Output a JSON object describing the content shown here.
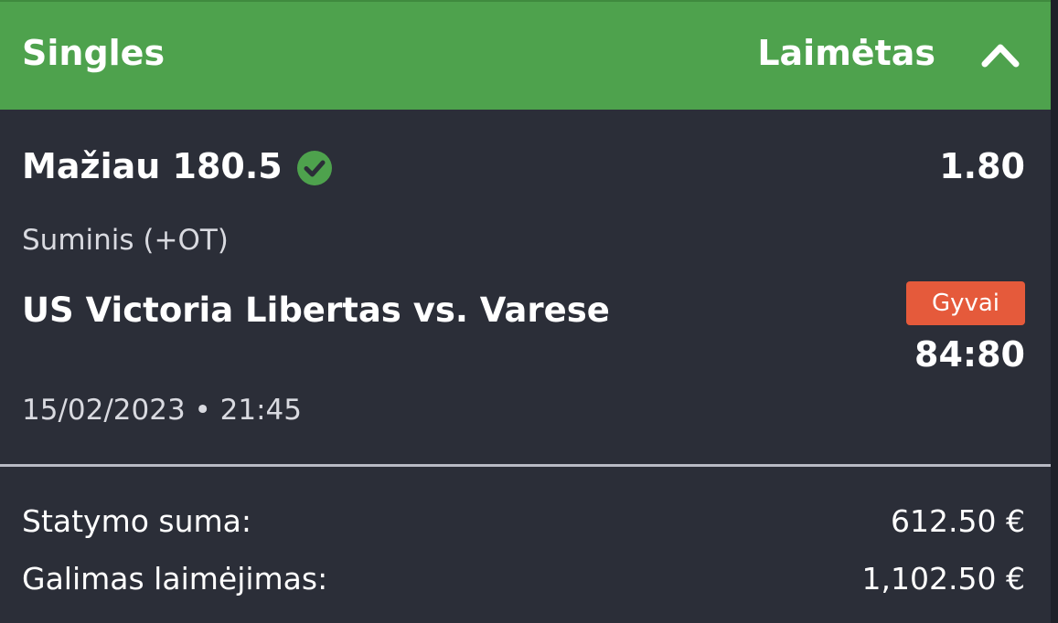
{
  "header": {
    "title": "Singles",
    "status": "Laimėtas",
    "accent_color": "#4ea24d",
    "toggle_icon": "chevron-up-icon"
  },
  "bet": {
    "selection": "Mažiau 180.5",
    "status_icon": "check-circle-icon",
    "odds": "1.80",
    "market": "Suminis (+OT)",
    "match": "US Victoria Libertas vs. Varese",
    "live_label": "Gyvai",
    "live_color": "#e55a3b",
    "score": "84:80",
    "datetime": "15/02/2023 • 21:45"
  },
  "summary": {
    "stake_label": "Statymo suma:",
    "stake_value": "612.50 €",
    "payout_label": "Galimas laimėjimas:",
    "payout_value": "1,102.50 €"
  }
}
